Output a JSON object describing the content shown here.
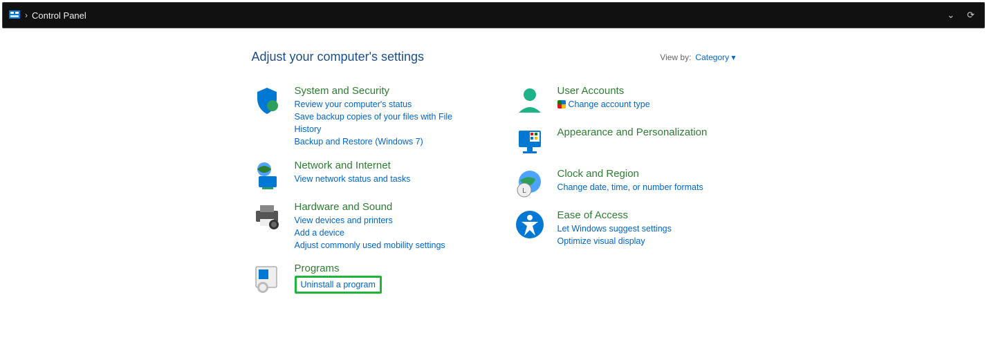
{
  "addressbar": {
    "location": "Control Panel",
    "sep": "›"
  },
  "heading": "Adjust your computer's settings",
  "viewby": {
    "label": "View by:",
    "value": "Category"
  },
  "categories": {
    "system_security": {
      "title": "System and Security",
      "links": [
        "Review your computer's status",
        "Save backup copies of your files with File History",
        "Backup and Restore (Windows 7)"
      ]
    },
    "network": {
      "title": "Network and Internet",
      "links": [
        "View network status and tasks"
      ]
    },
    "hardware": {
      "title": "Hardware and Sound",
      "links": [
        "View devices and printers",
        "Add a device",
        "Adjust commonly used mobility settings"
      ]
    },
    "programs": {
      "title": "Programs",
      "links": [
        "Uninstall a program"
      ]
    },
    "user_accounts": {
      "title": "User Accounts",
      "links": [
        "Change account type"
      ]
    },
    "appearance": {
      "title": "Appearance and Personalization",
      "links": []
    },
    "clock": {
      "title": "Clock and Region",
      "links": [
        "Change date, time, or number formats"
      ]
    },
    "ease": {
      "title": "Ease of Access",
      "links": [
        "Let Windows suggest settings",
        "Optimize visual display"
      ]
    }
  }
}
